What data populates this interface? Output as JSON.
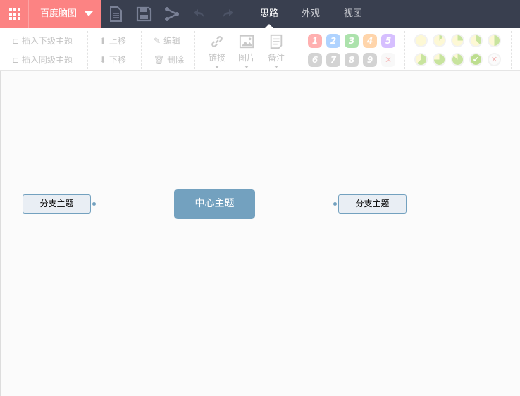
{
  "topbar": {
    "brand": "百度脑图",
    "tabs": [
      {
        "label": "思路",
        "active": true
      },
      {
        "label": "外观"
      },
      {
        "label": "视图"
      }
    ],
    "quick_icons": [
      "new-file-icon",
      "save-icon",
      "share-icon",
      "undo-icon",
      "redo-icon"
    ]
  },
  "toolbar": {
    "insert_child": "插入下级主题",
    "insert_sibling": "插入同级主题",
    "move_up": "上移",
    "move_down": "下移",
    "edit": "编辑",
    "delete": "删除",
    "link": "链接",
    "image": "图片",
    "note": "备注",
    "priorities": [
      {
        "label": "1",
        "color": "#ff7070"
      },
      {
        "label": "2",
        "color": "#6fb0ff"
      },
      {
        "label": "3",
        "color": "#69cc6a"
      },
      {
        "label": "4",
        "color": "#ffb468"
      },
      {
        "label": "5",
        "color": "#b58cff"
      },
      {
        "label": "6",
        "color": "#b0b0b0"
      },
      {
        "label": "7",
        "color": "#b0b0b0"
      },
      {
        "label": "8",
        "color": "#b0b0b0"
      },
      {
        "label": "9",
        "color": "#b0b0b0"
      }
    ],
    "progress_fractions": [
      0,
      0.125,
      0.25,
      0.375,
      0.5,
      0.625,
      0.75,
      0.875,
      1
    ]
  },
  "mindmap": {
    "root": "中心主题",
    "branches": [
      "分支主题",
      "分支主题"
    ],
    "color": "#73a1bf"
  }
}
